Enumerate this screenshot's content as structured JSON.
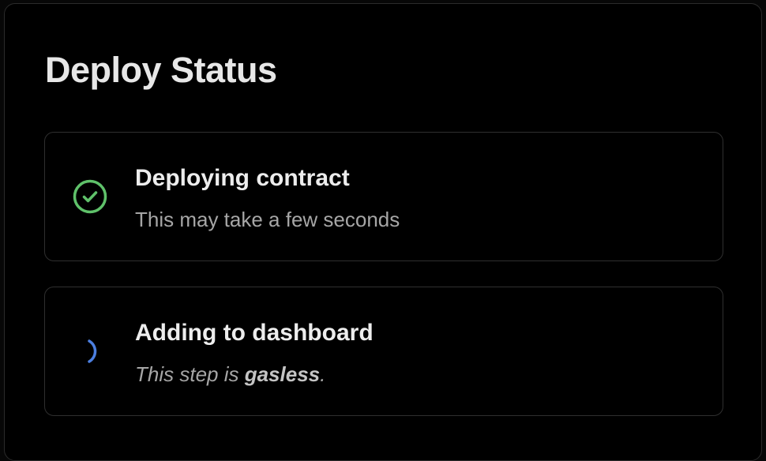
{
  "dialog": {
    "title": "Deploy Status"
  },
  "steps": [
    {
      "title": "Deploying contract",
      "description": "This may take a few seconds",
      "status": "complete",
      "icon": "check-circle-icon",
      "color": "#5fc16a"
    },
    {
      "title": "Adding to dashboard",
      "description_prefix": "This step is ",
      "description_bold": "gasless",
      "description_suffix": ".",
      "status": "loading",
      "icon": "spinner-icon",
      "color": "#4c7fe0"
    }
  ]
}
